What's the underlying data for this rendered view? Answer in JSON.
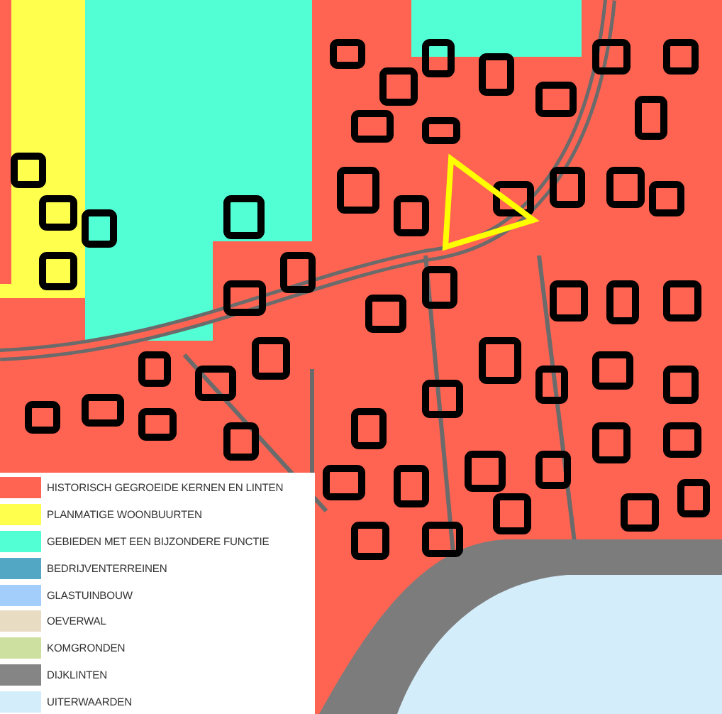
{
  "legend": {
    "items": [
      {
        "label": "HISTORISCH GEGROEIDE KERNEN EN LINTEN",
        "color": "#ff6452"
      },
      {
        "label": "PLANMATIGE WOONBUURTEN",
        "color": "#ffff4d"
      },
      {
        "label": "GEBIEDEN MET EEN BIJZONDERE FUNCTIE",
        "color": "#52ffd4"
      },
      {
        "label": "BEDRIJVENTERREINEN",
        "color": "#52a8c4"
      },
      {
        "label": "GLASTUINBOUW",
        "color": "#a3cdfa"
      },
      {
        "label": "OEVERWAL",
        "color": "#e8dcc2"
      },
      {
        "label": "KOMGRONDEN",
        "color": "#cde0a0"
      },
      {
        "label": "DIJKLINTEN",
        "color": "#858585"
      },
      {
        "label": "UITERWAARDEN",
        "color": "#d4edfa"
      }
    ]
  }
}
